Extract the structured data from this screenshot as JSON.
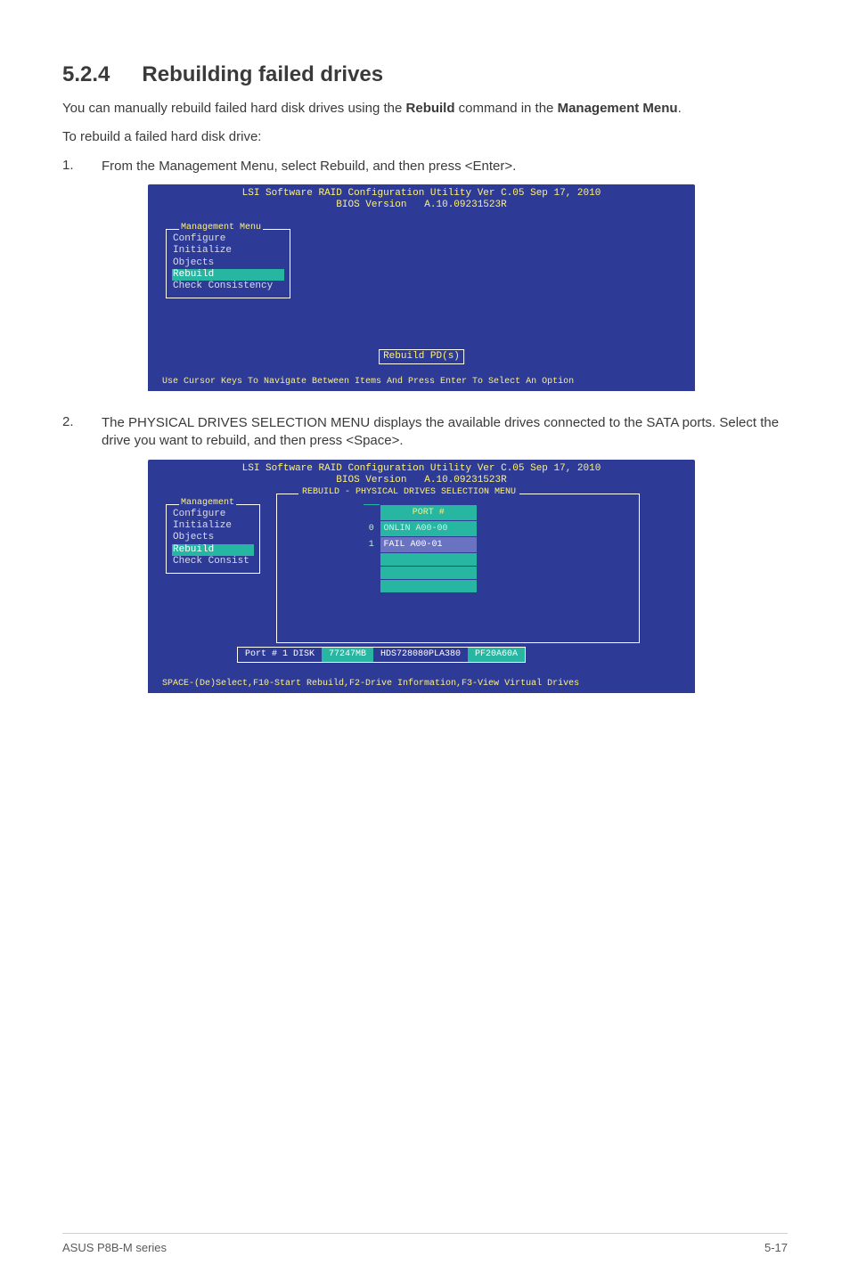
{
  "heading": {
    "number": "5.2.4",
    "title": "Rebuilding failed drives"
  },
  "intro1a": "You can manually rebuild failed hard disk drives using the ",
  "intro1b": "Rebuild",
  "intro1c": " command in the ",
  "intro1d": "Management Menu",
  "intro1e": ".",
  "intro2": "To rebuild a failed hard disk drive:",
  "step1": {
    "num": "1.",
    "a": "From the ",
    "b": "Management Menu",
    "c": ", select ",
    "d": "Rebuild",
    "e": ", and then press <Enter>."
  },
  "bios": {
    "title_line1": "LSI Software RAID Configuration Utility Ver C.05 Sep 17, 2010",
    "title_line2": "BIOS Version   A.10.09231523R",
    "mgmt_title": "Management Menu",
    "mgmt_items": [
      "Configure",
      "Initialize",
      "Objects",
      "Rebuild",
      "Check Consistency"
    ],
    "mgmt_selected_index": 3,
    "rebuild_pd": "Rebuild PD(s)",
    "footer1": "Use Cursor Keys To Navigate Between Items And Press Enter To Select An Option"
  },
  "step2": {
    "num": "2.",
    "a": "The ",
    "b": "PHYSICAL DRIVES SELECTION MENU",
    "c": " displays the available drives connected to the SATA ports. Select the drive you want to rebuild, and then press <Space>."
  },
  "bios2": {
    "subbox_title": "REBUILD - PHYSICAL DRIVES SELECTION MENU",
    "mgmt_title2": "Management",
    "mgmt_items2": [
      "Configure",
      "Initialize",
      "Objects",
      "Rebuild",
      "Check Consist"
    ],
    "mgmt_selected_index2": 3,
    "port_header": "PORT #",
    "rows": [
      {
        "idx": "0",
        "text": "ONLIN A00-00",
        "selected": false
      },
      {
        "idx": "1",
        "text": "FAIL  A00-01",
        "selected": true
      }
    ],
    "inline": {
      "a": "Port # 1 DISK",
      "b": "77247MB",
      "c": "HDS728080PLA380",
      "d": "PF20A60A"
    },
    "footer2": "SPACE-(De)Select,F10-Start Rebuild,F2-Drive Information,F3-View Virtual Drives"
  },
  "footer": {
    "left": "ASUS P8B-M series",
    "right": "5-17"
  }
}
